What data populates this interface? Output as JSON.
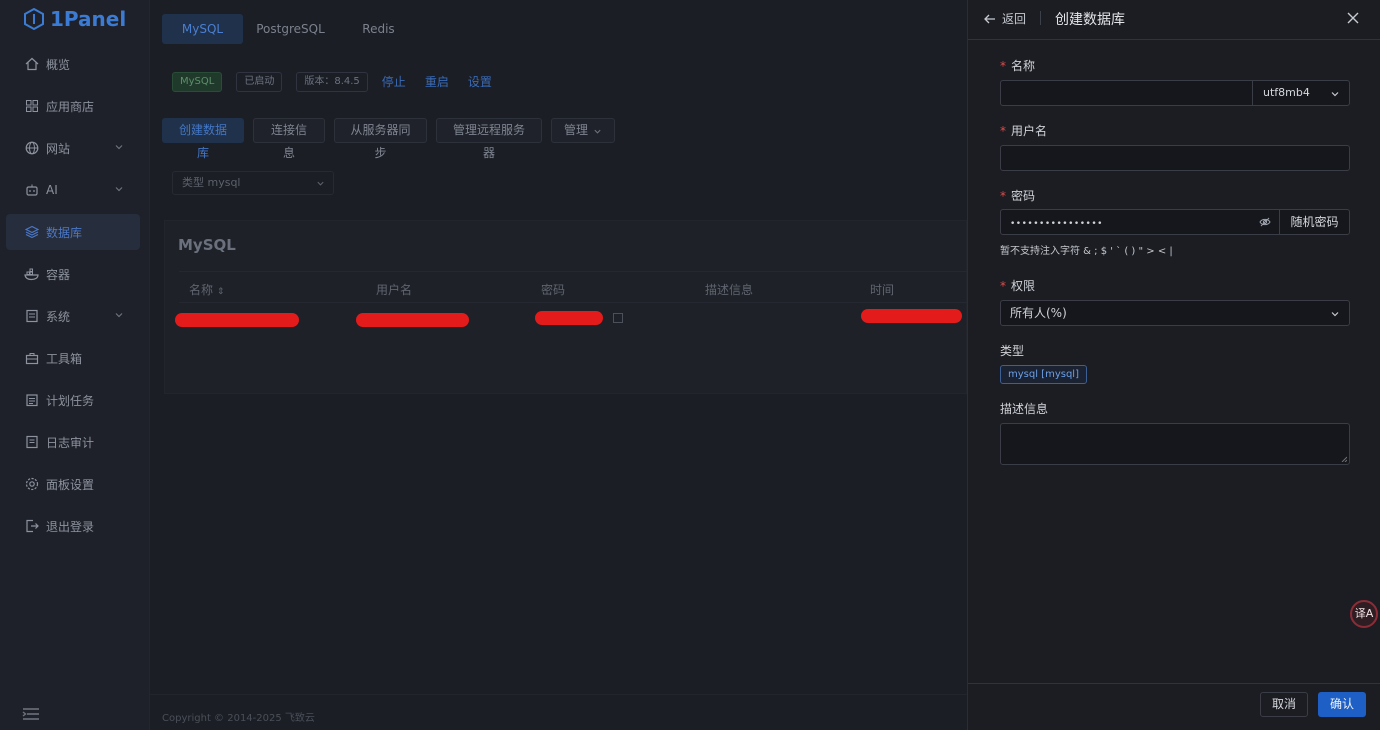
{
  "sidebar": {
    "logo": "1Panel",
    "items": [
      {
        "label": "概览",
        "icon": "home-icon"
      },
      {
        "label": "应用商店",
        "icon": "apps-icon"
      },
      {
        "label": "网站",
        "icon": "globe-icon"
      },
      {
        "label": "AI",
        "icon": "robot-icon"
      },
      {
        "label": "数据库",
        "icon": "layers-icon"
      },
      {
        "label": "容器",
        "icon": "container-icon"
      },
      {
        "label": "系统",
        "icon": "server-icon"
      },
      {
        "label": "工具箱",
        "icon": "toolbox-icon"
      },
      {
        "label": "计划任务",
        "icon": "calendar-icon"
      },
      {
        "label": "日志审计",
        "icon": "log-icon"
      },
      {
        "label": "面板设置",
        "icon": "gear-icon"
      },
      {
        "label": "退出登录",
        "icon": "logout-icon"
      }
    ]
  },
  "main": {
    "tabs": [
      "MySQL",
      "PostgreSQL",
      "Redis"
    ],
    "status": {
      "app_tag": "MySQL",
      "state_tag": "已启动",
      "version_tag": "版本：8.4.5",
      "stop": "停止",
      "restart": "重启",
      "settings": "设置"
    },
    "buttons": {
      "create": "创建数据库",
      "conn_info": "连接信息",
      "sync": "从服务器同步",
      "remote": "管理远程服务器",
      "manage": "管理"
    },
    "filter": "类型  mysql",
    "card_title": "MySQL",
    "columns": [
      "名称",
      "用户名",
      "密码",
      "描述信息",
      "时间"
    ],
    "copyright": "Copyright © 2014-2025 飞致云"
  },
  "drawer": {
    "back": "返回",
    "title": "创建数据库",
    "name_label": "名称",
    "name_value": "",
    "charset": "utf8mb4",
    "user_label": "用户名",
    "user_value": "",
    "password_label": "密码",
    "password_value": "••••••••••••••••",
    "random_password": "随机密码",
    "password_hint": "暂不支持注入字符 & ; $ ' ` ( ) \" > < |",
    "permission_label": "权限",
    "permission_value": "所有人(%)",
    "type_label": "类型",
    "type_tag": "mysql [mysql]",
    "description_label": "描述信息",
    "cancel": "取消",
    "confirm": "确认"
  },
  "translate_fab": "译A"
}
